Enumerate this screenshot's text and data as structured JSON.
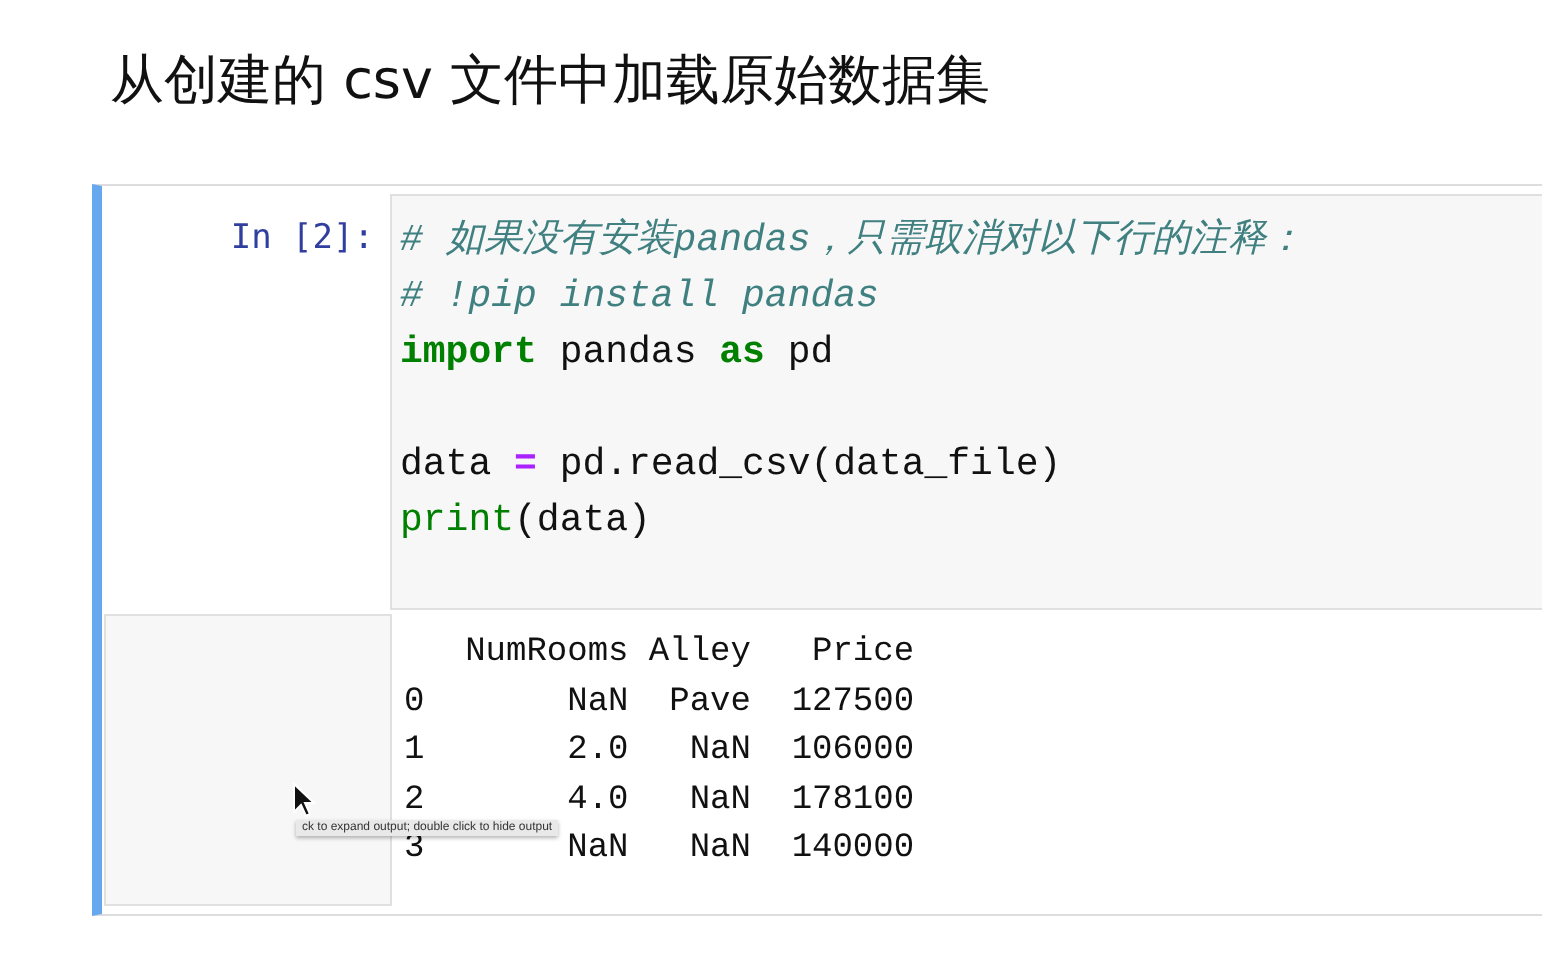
{
  "title": "从创建的 csv 文件中加载原始数据集",
  "cell": {
    "prompt": "In [2]:",
    "code": [
      [
        {
          "kind": "comment",
          "text": "# 如果没有安装pandas，只需取消对以下行的注释："
        }
      ],
      [
        {
          "kind": "comment",
          "text": "# !pip install pandas"
        }
      ],
      [
        {
          "kind": "keyword",
          "text": "import"
        },
        {
          "kind": "plain",
          "text": " pandas "
        },
        {
          "kind": "keyword",
          "text": "as"
        },
        {
          "kind": "plain",
          "text": " pd"
        }
      ],
      {
        "kind": "blank"
      },
      [
        {
          "kind": "plain",
          "text": "data "
        },
        {
          "kind": "operator",
          "text": "="
        },
        {
          "kind": "plain",
          "text": " pd.read_csv(data_file)"
        }
      ],
      [
        {
          "kind": "builtin",
          "text": "print"
        },
        {
          "kind": "plain",
          "text": "(data)"
        }
      ]
    ],
    "output": [
      "   NumRooms Alley   Price",
      "0       NaN  Pave  127500",
      "1       2.0   NaN  106000",
      "2       4.0   NaN  178100",
      "3       NaN   NaN  140000"
    ],
    "tooltip": "ck to expand output; double click to hide output"
  }
}
